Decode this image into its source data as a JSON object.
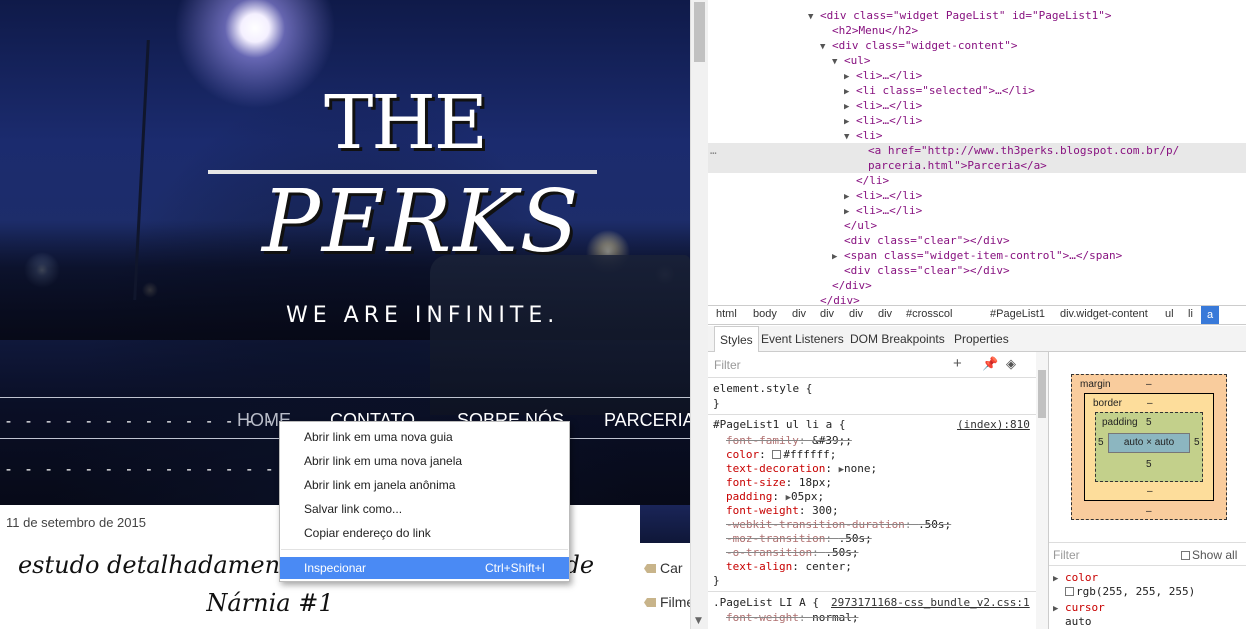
{
  "blog": {
    "title_line1": "THE",
    "title_line2": "PERKS",
    "tagline": "WE ARE INFINITE.",
    "nav": [
      "HOME",
      "CONTATO",
      "SOBRE NÓS",
      "PARCERIA"
    ],
    "dashes": "- - - - - - - - - - - - - - - - -",
    "post_date": "11 de setembro de 2015",
    "post_title_line1": "estudo detalhadamente da obra As Crônicas de",
    "post_title_line2": "Nárnia #1",
    "sidebar_items": [
      "Car",
      "Filme"
    ]
  },
  "context_menu": {
    "items": [
      "Abrir link em uma nova guia",
      "Abrir link em uma nova janela",
      "Abrir link em janela anônima",
      "Salvar link como...",
      "Copiar endereço do link"
    ],
    "inspect": "Inspecionar",
    "inspect_shortcut": "Ctrl+Shift+I"
  },
  "devtools": {
    "dom": {
      "widget_div_open": "<div class=\"widget PageList\" id=\"PageList1\">",
      "h2_menu": "<h2>Menu</h2>",
      "widget_content_open": "<div class=\"widget-content\">",
      "ul_open": "<ul>",
      "li_collapsed": "<li>…</li>",
      "li_selected": "<li class=\"selected\">…</li>",
      "li_open": "<li>",
      "a_href_part1": "<a href=\"http://www.th3perks.blogspot.com.br/p/",
      "a_href_part2": "parceria.html\">Parceria</a>",
      "li_close": "</li>",
      "ul_close": "</ul>",
      "div_clear": "<div class=\"clear\"></div>",
      "span_control": "<span class=\"widget-item-control\">…</span>",
      "div_close": "</div>",
      "ellipsis": "…"
    },
    "breadcrumbs": [
      "html",
      "body",
      "div",
      "div",
      "div",
      "div",
      "#crosscol",
      "#PageList1",
      "div.widget-content",
      "ul",
      "li",
      "a"
    ],
    "tabs": [
      "Styles",
      "Event Listeners",
      "DOM Breakpoints",
      "Properties"
    ],
    "styles_filter_placeholder": "Filter",
    "element_style_open": "element.style {",
    "brace_close": "}",
    "rule1": {
      "selector": "#PageList1 ul li a {",
      "source": "(index):810",
      "props": [
        {
          "name": "font-family",
          "value": "&#39;",
          "struck": true
        },
        {
          "name": "color",
          "value": "#ffffff",
          "struck": false,
          "swatch": true
        },
        {
          "name": "text-decoration",
          "value": "none",
          "struck": false,
          "arrow": true
        },
        {
          "name": "font-size",
          "value": "18px",
          "struck": false
        },
        {
          "name": "padding",
          "value": "05px",
          "struck": false,
          "arrow": true
        },
        {
          "name": "font-weight",
          "value": "300",
          "struck": false
        },
        {
          "name": "-webkit-transition-duration",
          "value": ".50s",
          "struck": true
        },
        {
          "name": "-moz-transition",
          "value": ".50s",
          "struck": true
        },
        {
          "name": "-o-transition",
          "value": ".50s",
          "struck": true
        },
        {
          "name": "text-align",
          "value": "center",
          "struck": false
        }
      ]
    },
    "rule2": {
      "selector": ".PageList LI A {",
      "source": "2973171168-css_bundle_v2.css:1",
      "props": [
        {
          "name": "font-weight",
          "value": "normal",
          "struck": true
        }
      ]
    },
    "box_model": {
      "margin_label": "margin",
      "border_label": "border",
      "padding_label": "padding",
      "padding_value": "5",
      "dash": "–",
      "content": "auto × auto"
    },
    "computed_filter_placeholder": "Filter",
    "show_all": "Show all",
    "computed": [
      {
        "name": "color",
        "value": "rgb(255, 255, 255)"
      },
      {
        "name": "cursor",
        "value": "auto"
      }
    ]
  },
  "colors": {
    "accent": "#4a8af4",
    "devtools_tag": "#881280",
    "devtools_attr": "#994500",
    "devtools_value": "#1a1aa6"
  }
}
